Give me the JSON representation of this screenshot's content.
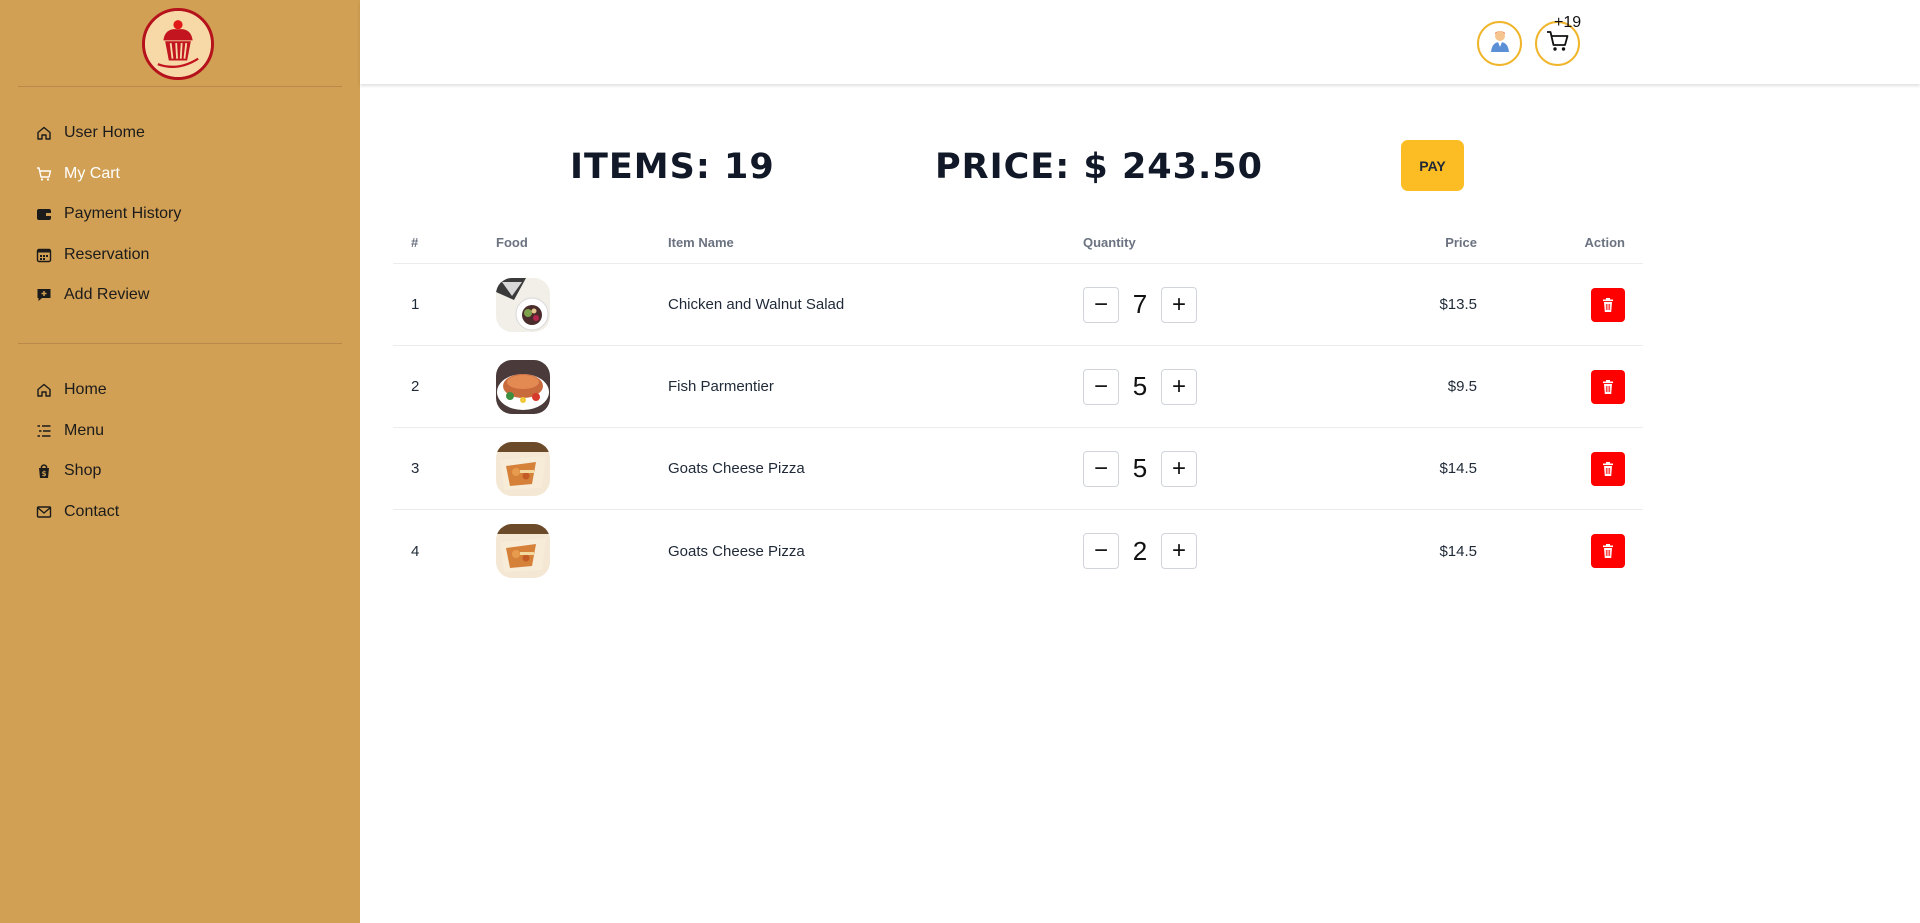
{
  "sidebar": {
    "logo_icon": "cake-stand-logo",
    "user_nav": [
      {
        "label": "User Home",
        "icon": "home-icon",
        "active": false
      },
      {
        "label": "My Cart",
        "icon": "cart-icon",
        "active": true
      },
      {
        "label": "Payment History",
        "icon": "wallet-icon",
        "active": false
      },
      {
        "label": "Reservation",
        "icon": "calendar-icon",
        "active": false
      },
      {
        "label": "Add Review",
        "icon": "review-icon",
        "active": false
      }
    ],
    "main_nav": [
      {
        "label": "Home",
        "icon": "home-icon"
      },
      {
        "label": "Menu",
        "icon": "menu-list-icon"
      },
      {
        "label": "Shop",
        "icon": "shopping-bag-icon"
      },
      {
        "label": "Contact",
        "icon": "mail-icon"
      }
    ],
    "colors": {
      "background": "#d1a054",
      "active_text": "#ffffff"
    }
  },
  "header": {
    "cart_count": "+19",
    "avatar_icon": "user-avatar-icon",
    "cart_icon": "cart-icon"
  },
  "summary": {
    "items_label": "ITEMS: 19",
    "price_label": "PRICE: $ 243.50",
    "pay_label": "PAY"
  },
  "table": {
    "headers": {
      "num": "#",
      "food": "Food",
      "name": "Item Name",
      "quantity": "Quantity",
      "price": "Price",
      "action": "Action"
    },
    "rows": [
      {
        "num": "1",
        "name": "Chicken and Walnut Salad",
        "qty": "7",
        "price": "$13.5",
        "thumb": "salad"
      },
      {
        "num": "2",
        "name": "Fish Parmentier",
        "qty": "5",
        "price": "$9.5",
        "thumb": "fish"
      },
      {
        "num": "3",
        "name": "Goats Cheese Pizza",
        "qty": "5",
        "price": "$14.5",
        "thumb": "pizza"
      },
      {
        "num": "4",
        "name": "Goats Cheese Pizza",
        "qty": "2",
        "price": "$14.5",
        "thumb": "pizza"
      }
    ],
    "minus_symbol": "−",
    "plus_symbol": "+"
  },
  "colors": {
    "pay_button": "#fbbd23",
    "delete_button": "#ff0000",
    "accent_border": "#f0b52a"
  }
}
